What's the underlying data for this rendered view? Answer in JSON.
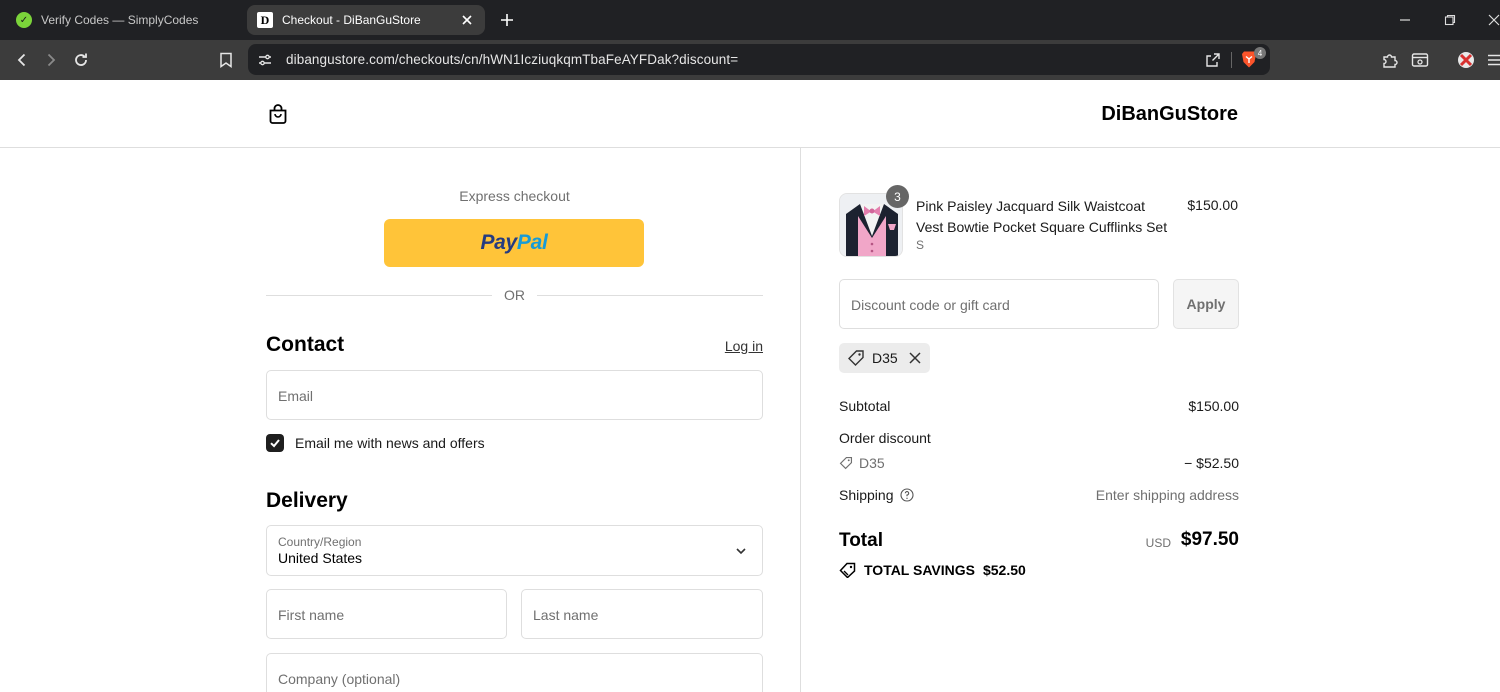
{
  "browser": {
    "tabs": [
      {
        "title": "Verify Codes — SimplyCodes",
        "active": false
      },
      {
        "title": "Checkout - DiBanGuStore",
        "active": true
      }
    ],
    "url": "dibangustore.com/checkouts/cn/hWN1Iczi​uqkqmTbaFeAYFDak?discount=",
    "brave_badge": "4"
  },
  "header": {
    "store_name": "DiBanGuStore"
  },
  "express": {
    "label": "Express checkout",
    "paypal_part1": "Pay",
    "paypal_part2": "Pal",
    "or_label": "OR"
  },
  "contact": {
    "title": "Contact",
    "login_label": "Log in",
    "email_placeholder": "Email",
    "newsletter_label": "Email me with news and offers",
    "newsletter_checked": true
  },
  "delivery": {
    "title": "Delivery",
    "country_label": "Country/Region",
    "country_value": "United States",
    "first_name_placeholder": "First name",
    "last_name_placeholder": "Last name",
    "company_placeholder": "Company (optional)"
  },
  "order": {
    "product": {
      "name": "Pink Paisley Jacquard Silk Waistcoat Vest Bowtie Pocket Square Cufflinks Set",
      "variant": "S",
      "price": "$150.00",
      "quantity": "3"
    },
    "discount_placeholder": "Discount code or gift card",
    "apply_label": "Apply",
    "applied_code": "D35",
    "subtotal_label": "Subtotal",
    "subtotal_value": "$150.00",
    "order_discount_label": "Order discount",
    "discount_code": "D35",
    "discount_value": "− $52.50",
    "shipping_label": "Shipping",
    "shipping_value": "Enter shipping address",
    "total_label": "Total",
    "total_currency": "USD",
    "total_value": "$97.50",
    "savings_label": "TOTAL SAVINGS",
    "savings_value": "$52.50"
  },
  "colors": {
    "paypal_yellow": "#ffc439",
    "paypal_dark_blue": "#253b80",
    "paypal_light_blue": "#179bd7",
    "checkbox_checked": "#1f1f1f"
  }
}
